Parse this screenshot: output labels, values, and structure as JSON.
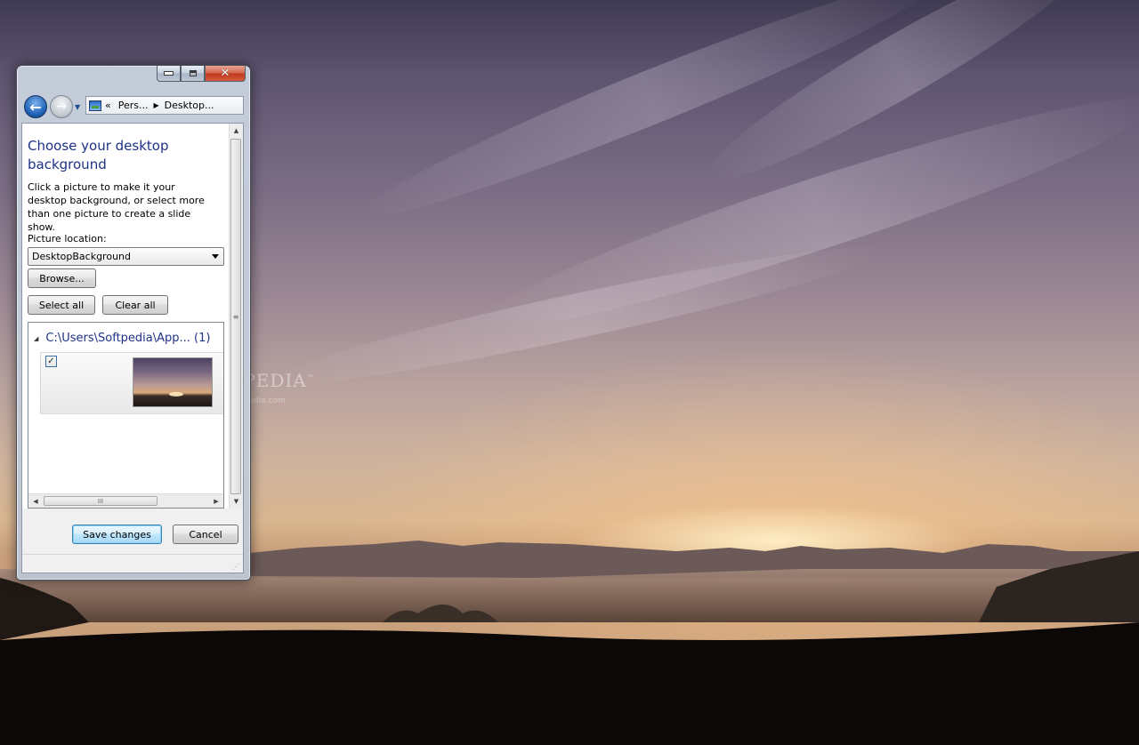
{
  "window": {
    "address": {
      "segment1": "Pers...",
      "segment2": "Desktop...",
      "prefix": "«"
    },
    "title": "Choose your desktop background",
    "description": "Click a picture to make it your desktop background, or select more than one picture to create a slide show.",
    "picture_location_label": "Picture location:",
    "picture_location_value": "DesktopBackground",
    "browse_label": "Browse...",
    "select_all_label": "Select all",
    "clear_all_label": "Clear all",
    "group": {
      "path": "C:\\Users\\Softpedia\\App... (1)"
    },
    "tile": {
      "checked": true,
      "check_glyph": "✓"
    },
    "save_label": "Save changes",
    "cancel_label": "Cancel",
    "scroll_grip": "≡",
    "hscroll_grip": "III"
  },
  "watermark": {
    "name": "SOFTPEDIA",
    "url": "www.softpedia.com"
  },
  "icons": [
    "minimize-icon",
    "maximize-icon",
    "close-icon",
    "back-arrow-icon",
    "forward-arrow-icon",
    "control-panel-icon"
  ],
  "colors": {
    "title_blue": "#1e3287",
    "close_red": "#c0391e"
  }
}
